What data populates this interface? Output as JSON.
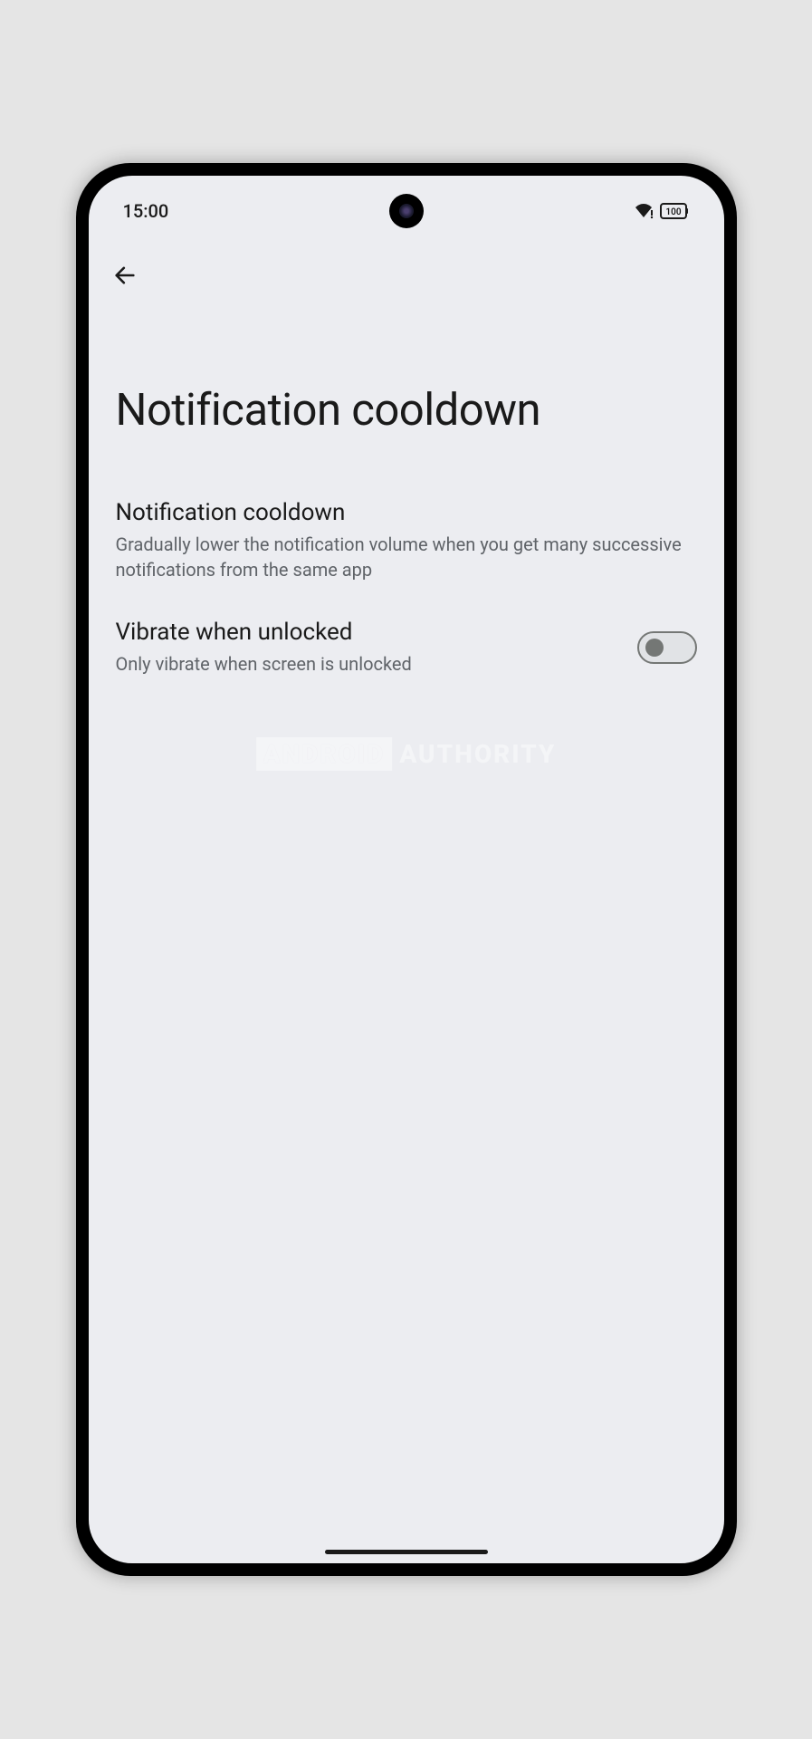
{
  "status": {
    "time": "15:00",
    "battery": "100"
  },
  "page": {
    "title": "Notification cooldown"
  },
  "settings": [
    {
      "title": "Notification cooldown",
      "subtitle": "Gradually lower the notification volume when you get many successive notifications from the same app",
      "hasToggle": false
    },
    {
      "title": "Vibrate when unlocked",
      "subtitle": "Only vibrate when screen is unlocked",
      "hasToggle": true,
      "toggled": false
    }
  ],
  "watermark": {
    "part1": "ANDROID",
    "part2": "AUTHORITY"
  }
}
